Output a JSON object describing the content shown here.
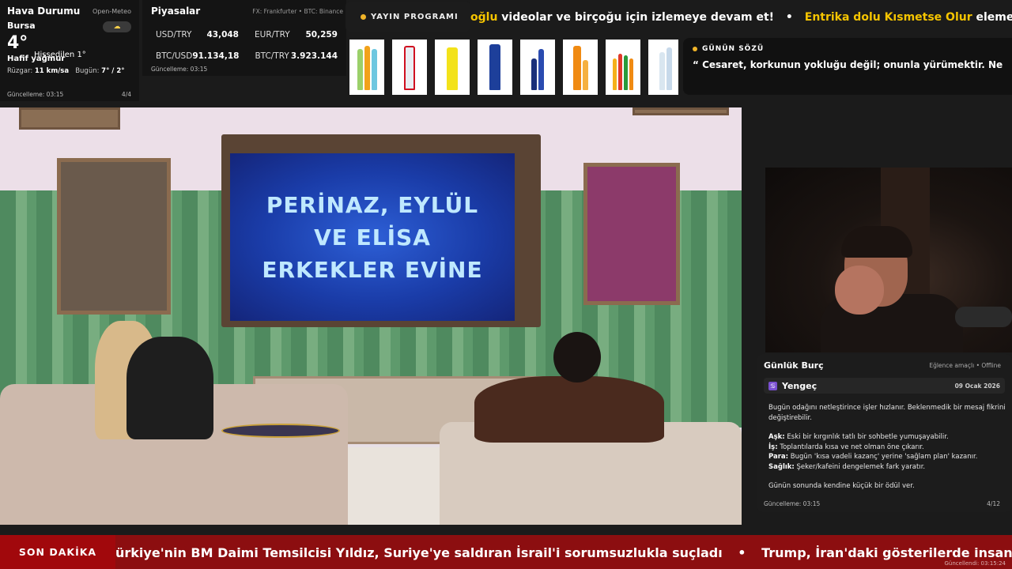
{
  "weather": {
    "title": "Hava Durumu",
    "source": "Open-Meteo",
    "city": "Bursa",
    "icon": "cloud-rain-icon",
    "temperature": "4°",
    "feels_like": "Hissedilen 1°",
    "condition": "Hafif yağmur",
    "wind_label": "Rüzgar:",
    "wind_value": "11 km/sa",
    "today_label": "Bugün:",
    "today_value": "7° / 2°",
    "updated": "Güncelleme: 03:15",
    "page": "4/4"
  },
  "markets": {
    "title": "Piyasalar",
    "source": "FX: Frankfurter • BTC: Binance",
    "rows": [
      [
        {
          "label": "USD/TRY",
          "value": "43,048"
        },
        {
          "label": "EUR/TRY",
          "value": "50,259"
        }
      ],
      [
        {
          "label": "BTC/USD",
          "value": "91.134,18"
        },
        {
          "label": "BTC/TRY",
          "value": "3.923.144"
        }
      ]
    ],
    "updated": "Güncelleme: 03:15"
  },
  "schedule": {
    "label": "YAYIN PROGRAMI"
  },
  "top_ticker": {
    "items": [
      {
        "pre": "oğlu",
        "text": " videolar ve birçoğu için izlemeye devam et!"
      },
      {
        "pre": "Entrika dolu Kısmetse Olur",
        "text": " eleme ge"
      }
    ],
    "separator": "•"
  },
  "quote": {
    "title": "GÜNÜN SÖZÜ",
    "text": "“ Cesaret, korkunun yokluğu değil; onunla yürümektir. Ne"
  },
  "video": {
    "tv_lines": [
      "PERİNAZ, EYLÜL",
      "VE ELİSA",
      "ERKEKLER EVİNE"
    ]
  },
  "horoscope": {
    "title": "Günlük Burç",
    "note": "Eğlence amaçlı • Offline",
    "sign_icon": "zodiac-icon",
    "sign": "Yengeç",
    "date": "09 Ocak 2026",
    "intro": "Bugün odağını netleştirince işler hızlanır. Beklenmedik bir mesaj fikrini değiştirebilir.",
    "lines": [
      {
        "label": "Aşk:",
        "text": " Eski bir kırgınlık tatlı bir sohbetle yumuşayabilir."
      },
      {
        "label": "İş:",
        "text": " Toplantılarda kısa ve net olman öne çıkarır."
      },
      {
        "label": "Para:",
        "text": " Bugün 'kısa vadeli kazanç' yerine 'sağlam plan' kazanır."
      },
      {
        "label": "Sağlık:",
        "text": " Şeker/kafeini dengelemek fark yaratır."
      }
    ],
    "closing": "Günün sonunda kendine küçük bir ödül ver.",
    "updated": "Güncelleme: 03:15",
    "page": "4/12"
  },
  "breaking": {
    "label": "SON DAKİKA",
    "items": [
      "ürkiye'nin BM Daimi Temsilcisi Yıldız, Suriye'ye saldıran İsrail'i sorumsuzlukla suçladı",
      "Trump, İran'daki gösterilerde insanların ö"
    ],
    "separator": "•",
    "updated": "Güncellendi: 03:15:24"
  },
  "colors": {
    "accent": "#f0b429",
    "ticker_highlight": "#f5c400",
    "breaking_bg": "#8c0e10",
    "panel_bg": "#141414"
  }
}
